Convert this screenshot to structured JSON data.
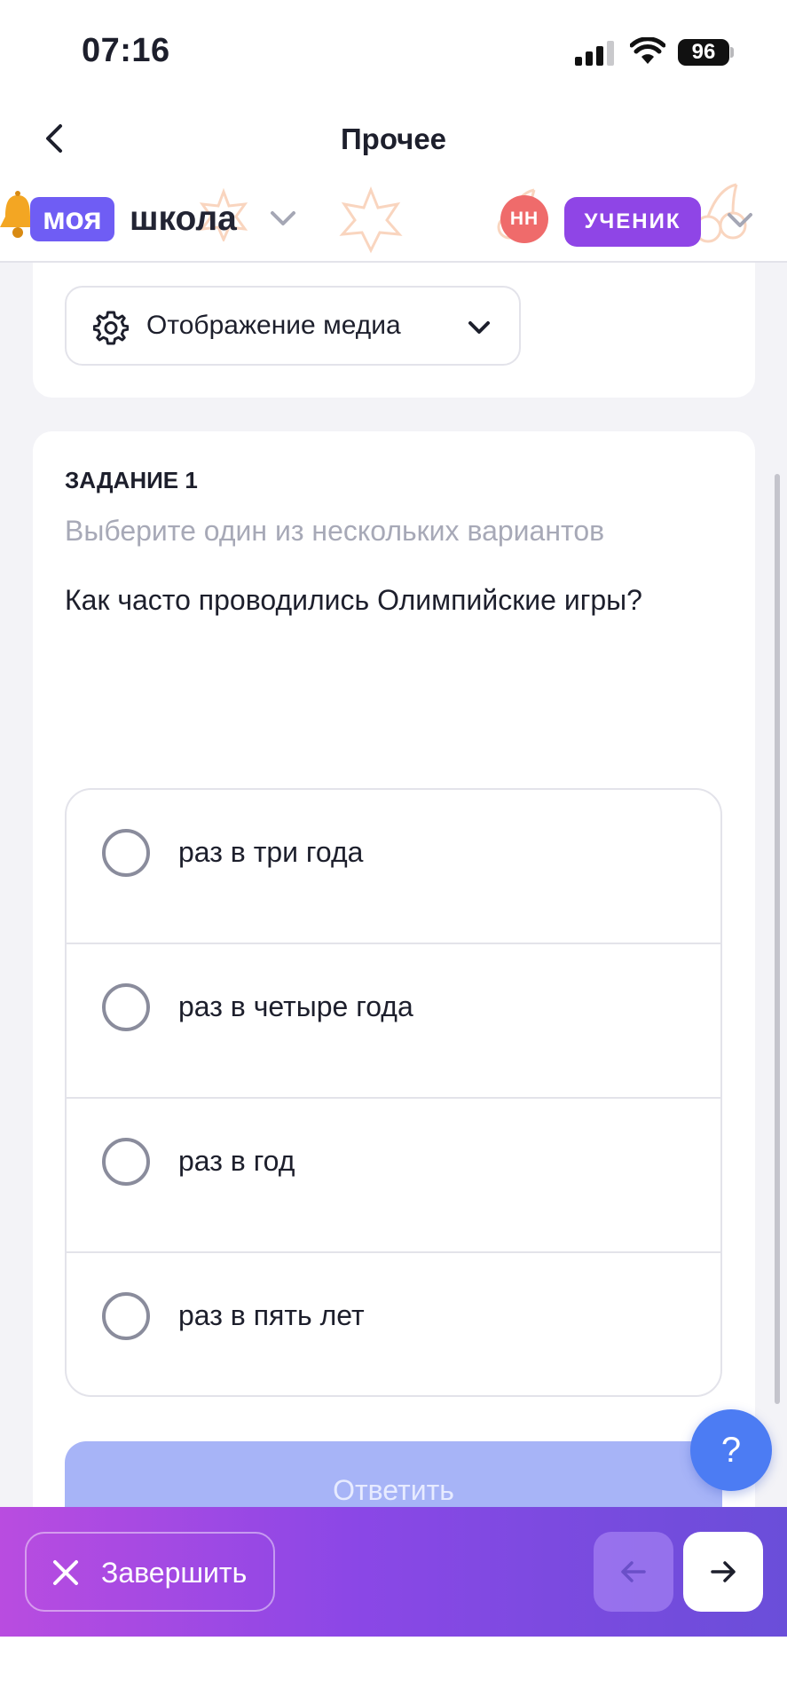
{
  "status_bar": {
    "time": "07:16",
    "battery": "96"
  },
  "nav": {
    "title": "Прочее"
  },
  "header": {
    "logo_part1": "моя",
    "logo_part2": "школа",
    "avatar_initials": "НН",
    "role": "УЧЕНИК"
  },
  "media": {
    "label": "Отображение медиа"
  },
  "task": {
    "number": "ЗАДАНИЕ 1",
    "hint": "Выберите один из нескольких вариантов",
    "question": "Как часто проводились Олимпийские игры?",
    "options": [
      {
        "label": "раз в три года"
      },
      {
        "label": "раз в четыре года"
      },
      {
        "label": "раз в год"
      },
      {
        "label": "раз в пять лет"
      }
    ],
    "answer_button": "Ответить"
  },
  "help": {
    "label": "?"
  },
  "bottom_bar": {
    "finish_label": "Завершить"
  },
  "colors": {
    "accent_purple": "#8f45e6",
    "logo_purple": "#6f5df4",
    "avatar_red": "#ef6b6b",
    "help_blue": "#4c7cf3",
    "answer_disabled": "#a7b4f7"
  }
}
